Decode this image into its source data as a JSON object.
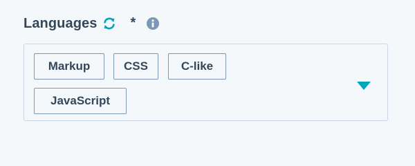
{
  "field": {
    "label": "Languages",
    "required_mark": "*"
  },
  "tags": [
    "Markup",
    "CSS",
    "C-like",
    "JavaScript"
  ],
  "icons": {
    "sync": "sync-icon",
    "info": "info-icon",
    "caret": "caret-down-icon"
  },
  "colors": {
    "label": "#33475b",
    "sync_accent": "#00a4bd",
    "info": "#7c98b6",
    "caret": "#00a4bd",
    "tag_border": "#7c98b6",
    "box_border": "#cbd6e2",
    "background": "#f5f8fa"
  }
}
